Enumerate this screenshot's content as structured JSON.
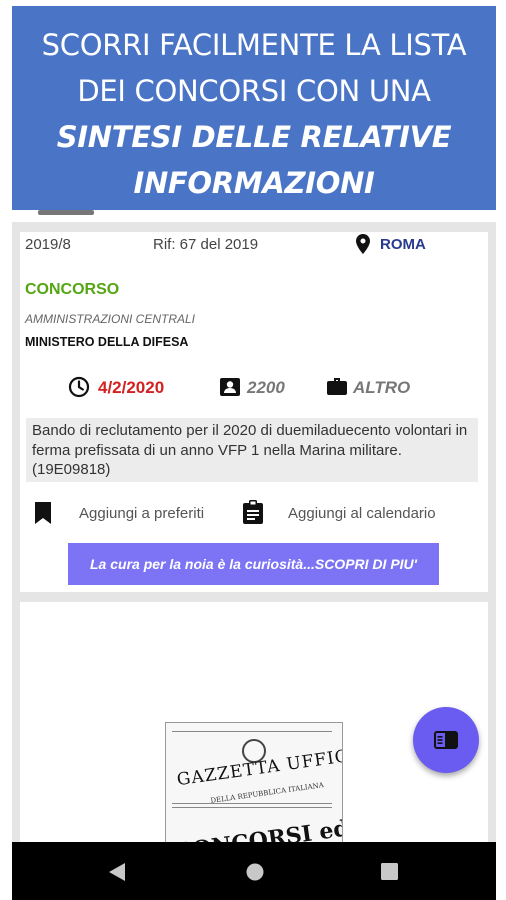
{
  "banner": {
    "line1": "SCORRI FACILMENTE LA LISTA",
    "line2": "DEI CONCORSI CON UNA",
    "line3": "SINTESI DELLE RELATIVE",
    "line4": "INFORMAZIONI"
  },
  "card": {
    "number": "2019/8",
    "ref": "Rif: 67 del 2019",
    "location": "ROMA",
    "category": "CONCORSO",
    "admin_type": "AMMINISTRAZIONI CENTRALI",
    "ministry": "MINISTERO DELLA DIFESA",
    "deadline": "4/2/2020",
    "positions": "2200",
    "type": "ALTRO",
    "description": "Bando di reclutamento per il 2020 di duemiladuecento volontari in ferma prefissata di un anno VFP 1 nella Marina militare. (19E09818)",
    "add_favorites": "Aggiungi a preferiti",
    "add_calendar": "Aggiungi al calendario",
    "promo": "La cura per la noia è la curiosità...SCOPRI DI PIU'"
  },
  "gazzetta": {
    "title": "GAZZETTA UFFICIALE",
    "subtitle": "DELLA REPUBBLICA ITALIANA",
    "headline": "CONCORSI ed ESAMI"
  },
  "icons": {
    "location": "map-pin-icon",
    "deadline": "clock-icon",
    "positions": "badge-icon",
    "type": "briefcase-icon",
    "favorites": "bookmark-icon",
    "calendar": "clipboard-icon",
    "fab": "sidebar-panel-icon",
    "nav_back": "back-triangle-icon",
    "nav_home": "home-circle-icon",
    "nav_recent": "recent-square-icon"
  },
  "colors": {
    "banner": "#4a74c6",
    "category": "#55a514",
    "deadline": "#d32020",
    "location": "#2a3a8f",
    "promo": "#7d74f5",
    "fab": "#6a5cf0"
  }
}
